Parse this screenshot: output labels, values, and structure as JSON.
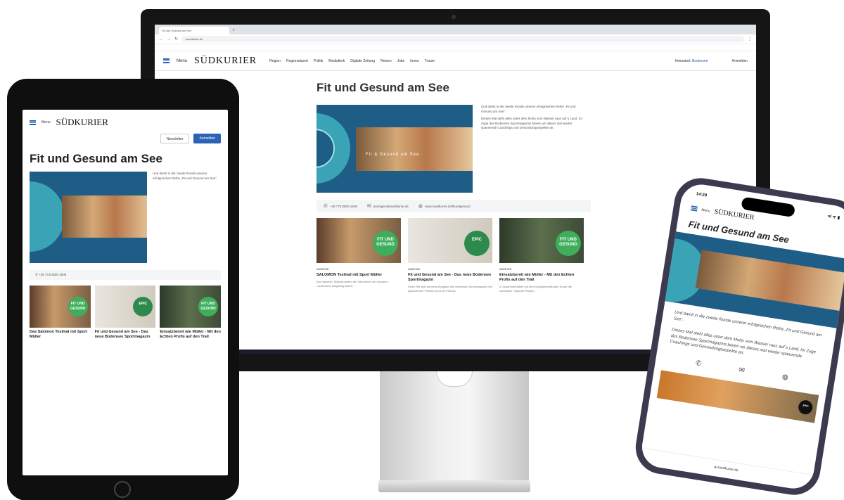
{
  "colors": {
    "brand_blue": "#2a62b5",
    "teal": "#3aa3b5",
    "hero_blue": "#1e5d86",
    "badge_green": "#3fae5b",
    "frame_dark": "#151515",
    "phone_frame": "#3d3a4f"
  },
  "desktop": {
    "menu_label": "Menu",
    "logo": "SÜDKURIER",
    "nav": [
      "Region",
      "Regionalsport",
      "Politik",
      "Mediathek",
      "Digitale Zeitung",
      "Reisen",
      "Jobs",
      "Immo",
      "Trauer"
    ],
    "heimatort_label": "Heimatort:",
    "heimatort_value": "Bodensee",
    "login": "Anmelden",
    "page_title": "Fit und Gesund am See",
    "hero_overlay": "Fit & Gesund am See",
    "hero_text": [
      "Und damit in die zweite Runde unserer erfolgreichen Reihe „Fit und Gesund am See“.",
      "Dieses Mal steht alles unter dem Motto vom Wasser raus auf´s Land. Im Zuge des Bodensee Sportmagazins bieten wir dieses mal wieder spannende Coachings und Gesundungsaspekte an."
    ],
    "contact": [
      "+49 7731/800-1509",
      "anzeigen@suedkurier.de",
      "www.suedkurier.de/fitundgesund"
    ],
    "cards": [
      {
        "kicker": "ANZEIGE",
        "title": "SALOMON Testival mit Sport Müller",
        "text": "Am Salomon Testival durften die Teilnehmer die neuesten Laufschuhe ausgiebig testen.",
        "badge": "FIT UND GESUND"
      },
      {
        "kicker": "ANZEIGE",
        "title": "Fit und Gesund am See - Das neue Bodensee Sportmagazin",
        "text": "Holen Sie sich die neue Ausgabe des Bodensee Sportmagazins mit spannenden Themen rund um Fitness.",
        "badge": "EPIC"
      },
      {
        "kicker": "ANZEIGE",
        "title": "Einsatzbereit wie Müller - Mit den Echten Profis auf den Trail",
        "text": "In Zusammenarbeit mit dem Sportgeschäft geht es auf die schönsten Trails der Region.",
        "badge": "FIT UND GESUND"
      }
    ]
  },
  "tablet": {
    "menu_label": "Menu",
    "logo": "SÜDKURIER",
    "btn_newsletter": "Newsletter",
    "btn_login": "Anmelden",
    "page_title": "Fit und Gesund am See",
    "contact": "+49 7731/800-1509",
    "cards": [
      {
        "title": "Das Salomon Testival mit Sport Müller"
      },
      {
        "title": "Fit und Gesund am See - Das neue Bodensee Sportmagazin"
      },
      {
        "title": "Einsatzbereit wie Müller - Mit den Echten Profis auf den Trail"
      }
    ]
  },
  "phone": {
    "time": "14:29",
    "signal": "•ıl ᯤ ▮",
    "menu_label": "Menu",
    "logo": "SÜDKURIER",
    "page_title": "Fit und Gesund am See",
    "text": [
      "Und damit in die zweite Runde unserer erfolgreichen Reihe „Fit und Gesund am See“.",
      "Dieses Mal steht alles unter dem Motto vom Wasser raus auf´s Land. Im Zuge des Bodensee Sportmagazins bieten wir dieses mal wieder spannende Coachings und Gesundungsaspekte an."
    ],
    "icons": [
      "phone-icon",
      "mail-icon",
      "globe-icon"
    ],
    "strip_badge": "EPIC",
    "footer_url": "suedkurier.de"
  }
}
